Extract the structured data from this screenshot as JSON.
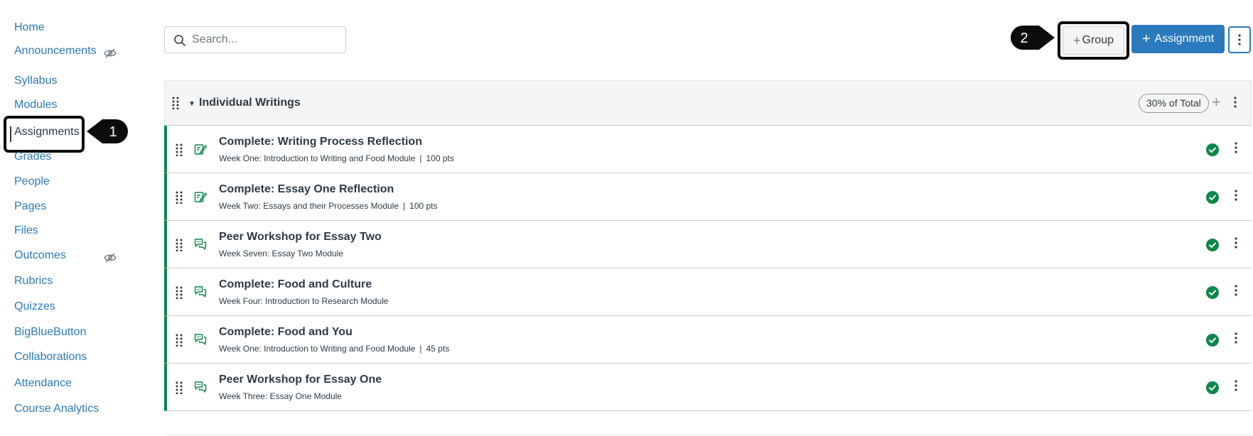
{
  "sidebar": {
    "items": [
      {
        "label": "Home",
        "hidden": false
      },
      {
        "label": "Announcements",
        "hidden": true
      },
      {
        "label": "Syllabus",
        "hidden": false
      },
      {
        "label": "Modules",
        "hidden": false
      },
      {
        "label": "Assignments",
        "hidden": false,
        "active": true
      },
      {
        "label": "Grades",
        "hidden": false
      },
      {
        "label": "People",
        "hidden": false
      },
      {
        "label": "Pages",
        "hidden": false
      },
      {
        "label": "Files",
        "hidden": false
      },
      {
        "label": "Outcomes",
        "hidden": true
      },
      {
        "label": "Rubrics",
        "hidden": false
      },
      {
        "label": "Quizzes",
        "hidden": false
      },
      {
        "label": "BigBlueButton",
        "hidden": false
      },
      {
        "label": "Collaborations",
        "hidden": false
      },
      {
        "label": "Attendance",
        "hidden": false
      },
      {
        "label": "Course Analytics",
        "hidden": false
      }
    ]
  },
  "callouts": {
    "one": "1",
    "two": "2"
  },
  "toolbar": {
    "search_placeholder": "Search...",
    "group_plus": "+",
    "group_label": "Group",
    "assignment_plus": "+",
    "assignment_label": "Assignment"
  },
  "group": {
    "title": "Individual Writings",
    "weight": "30% of Total",
    "assignments": [
      {
        "title": "Complete: Writing Process Reflection",
        "module": "Week One: Introduction to Writing and Food Module",
        "points": "100 pts",
        "type": "quiz-icon"
      },
      {
        "title": "Complete: Essay One Reflection",
        "module": "Week Two: Essays and their Processes Module",
        "points": "100 pts",
        "type": "quiz-icon"
      },
      {
        "title": "Peer Workshop for Essay Two",
        "module": "Week Seven: Essay Two Module",
        "points": "",
        "type": "discussion-icon"
      },
      {
        "title": "Complete: Food and Culture",
        "module": "Week Four: Introduction to Research Module",
        "points": "",
        "type": "discussion-icon"
      },
      {
        "title": "Complete: Food and You",
        "module": "Week One: Introduction to Writing and Food Module",
        "points": "45 pts",
        "type": "discussion-icon"
      },
      {
        "title": "Peer Workshop for Essay One",
        "module": "Week Three: Essay One Module",
        "points": "",
        "type": "discussion-icon"
      }
    ]
  },
  "colors": {
    "link": "#2b7abc",
    "text": "#2d3b45",
    "published": "#0b874b",
    "callout": "#0c0c0c"
  }
}
